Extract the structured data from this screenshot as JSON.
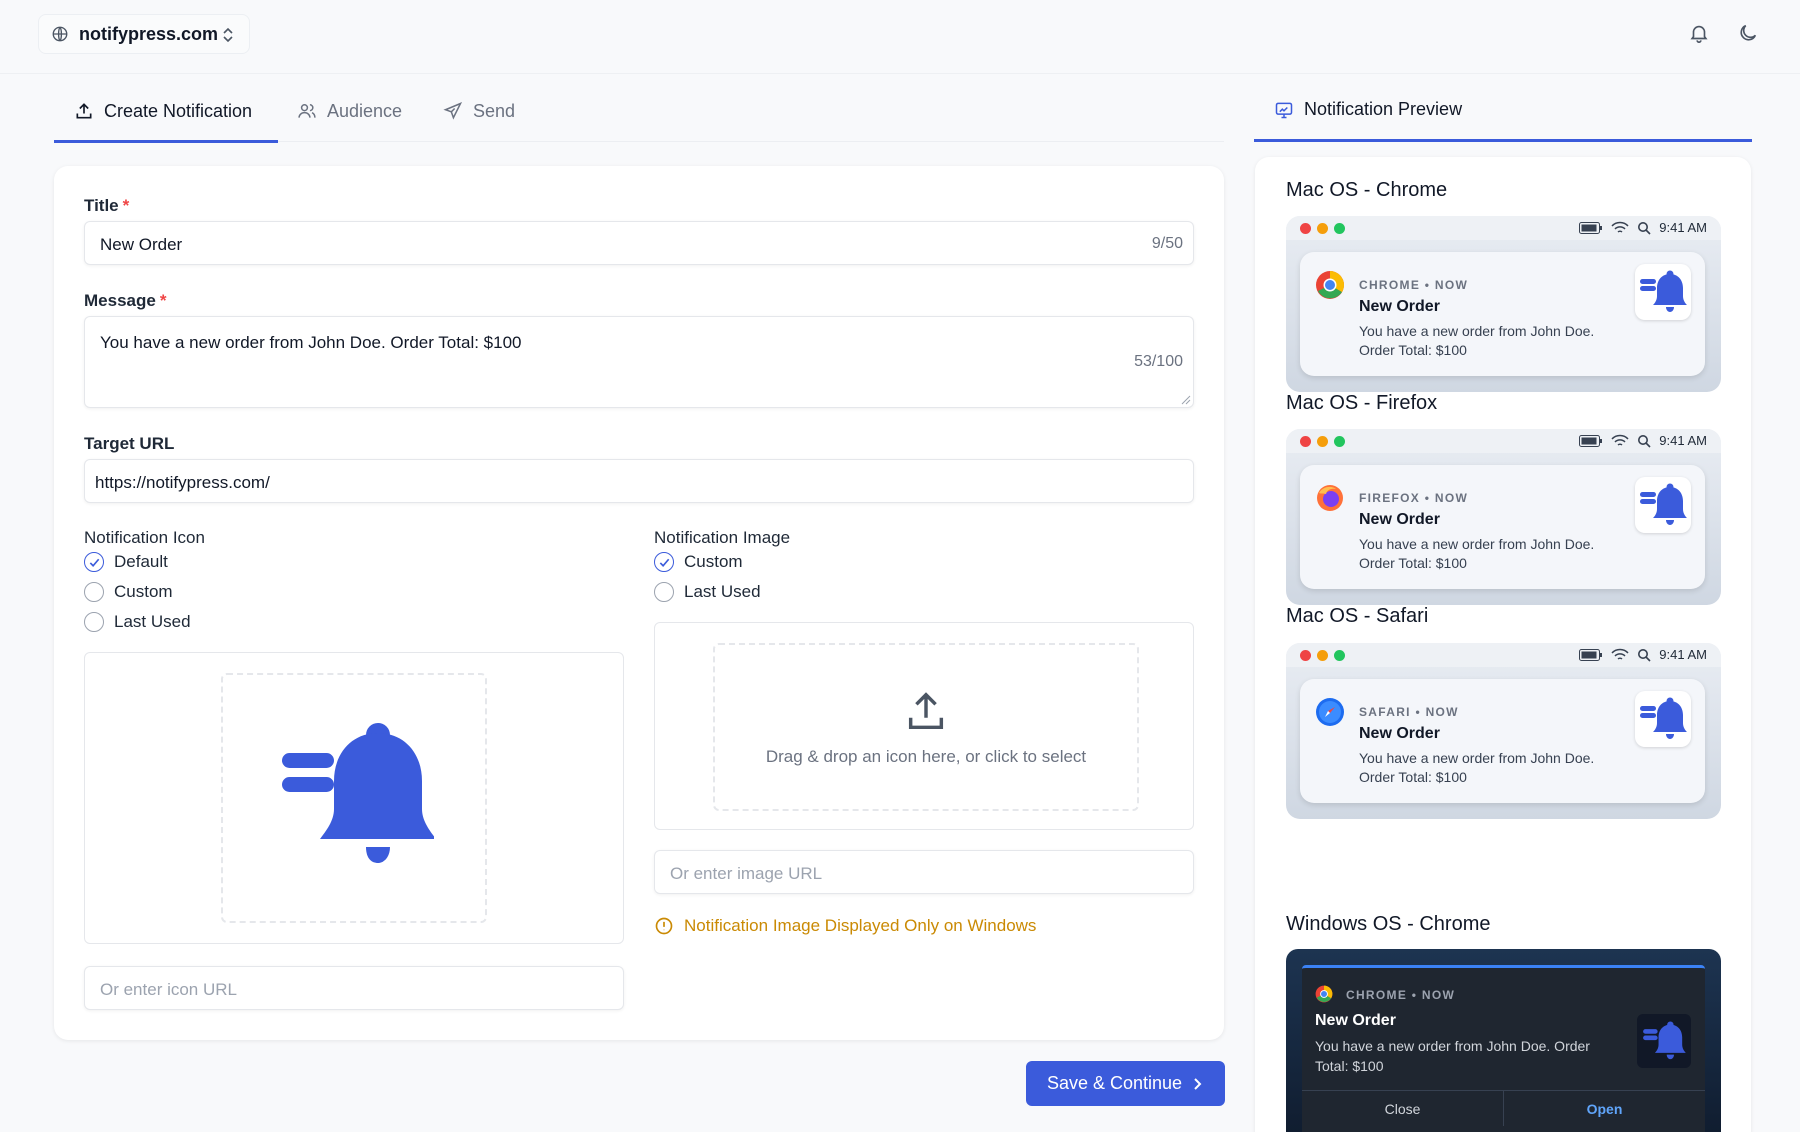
{
  "header": {
    "site": "notifypress.com"
  },
  "tabs": [
    {
      "label": "Create Notification"
    },
    {
      "label": "Audience"
    },
    {
      "label": "Send"
    }
  ],
  "preview_tab": {
    "label": "Notification Preview"
  },
  "form": {
    "title_label": "Title",
    "title_value": "New Order",
    "title_count": "9/50",
    "message_label": "Message",
    "message_value": "You have a new order from John Doe. Order Total: $100",
    "message_count": "53/100",
    "required_mark": "*",
    "target_url_label": "Target URL",
    "target_url_value": "https://notifypress.com/",
    "icon_section": {
      "label": "Notification Icon",
      "options": [
        "Default",
        "Custom",
        "Last Used"
      ],
      "selected": "Default",
      "url_placeholder": "Or enter icon URL"
    },
    "image_section": {
      "label": "Notification Image",
      "options": [
        "Custom",
        "Last Used"
      ],
      "selected": "Custom",
      "drop_text": "Drag & drop an icon here, or click to select",
      "url_placeholder": "Or enter image URL",
      "warning": "Notification Image Displayed Only on Windows"
    },
    "save_label": "Save & Continue"
  },
  "previews": {
    "mac_chrome": {
      "title": "Mac OS - Chrome",
      "meta": "CHROME • NOW"
    },
    "mac_firefox": {
      "title": "Mac OS - Firefox",
      "meta": "FIREFOX • NOW"
    },
    "mac_safari": {
      "title": "Mac OS - Safari",
      "meta": "SAFARI • NOW"
    },
    "win_chrome": {
      "title": "Windows OS - Chrome",
      "meta": "CHROME • NOW",
      "close": "Close",
      "open": "Open"
    },
    "time": "9:41 AM",
    "notif_title": "New Order",
    "notif_body": "You have a new order from John Doe. Order Total: $100"
  },
  "colors": {
    "accent": "#3b5bdb",
    "warning": "#ca8a04",
    "required": "#ef4444"
  }
}
